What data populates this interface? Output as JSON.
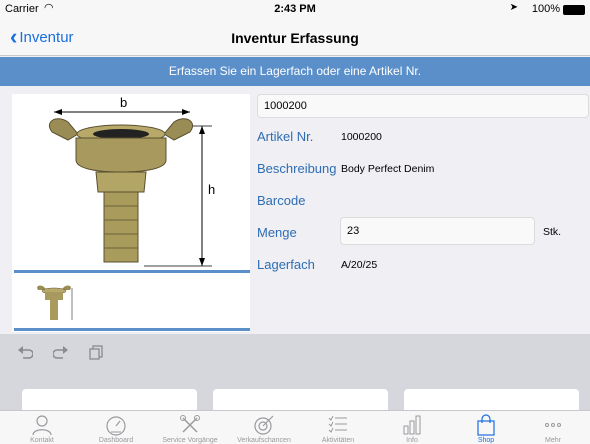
{
  "status_bar": {
    "carrier": "Carrier",
    "time": "2:43 PM",
    "battery": "100%"
  },
  "nav": {
    "back_label": "Inventur",
    "title": "Inventur Erfassung"
  },
  "banner": {
    "text": "Erfassen Sie ein Lagerfach oder eine Artikel Nr."
  },
  "image": {
    "dim_b": "b",
    "dim_h": "h"
  },
  "form": {
    "search_value": "1000200",
    "artikel_label": "Artikel Nr.",
    "artikel_value": "1000200",
    "beschreibung_label": "Beschreibung",
    "beschreibung_value": "Body Perfect Denim",
    "barcode_label": "Barcode",
    "menge_label": "Menge",
    "menge_value": "23",
    "menge_unit": "Stk.",
    "lagerfach_label": "Lagerfach",
    "lagerfach_value": "A/20/25"
  },
  "tabs": [
    {
      "label": "Kontakt",
      "icon": "person-icon"
    },
    {
      "label": "Dashboard",
      "icon": "speedometer-icon"
    },
    {
      "label": "Service Vorgänge",
      "icon": "tools-icon"
    },
    {
      "label": "Verkaufschancen",
      "icon": "target-icon"
    },
    {
      "label": "Aktivitäten",
      "icon": "checklist-icon"
    },
    {
      "label": "Info",
      "icon": "bar-chart-icon"
    },
    {
      "label": "Shop",
      "icon": "shopping-bag-icon",
      "active": true
    },
    {
      "label": "Mehr",
      "icon": "more-icon"
    }
  ],
  "colors": {
    "accent": "#1a6fe0",
    "banner": "#5b8fca",
    "label": "#2e6db4"
  }
}
